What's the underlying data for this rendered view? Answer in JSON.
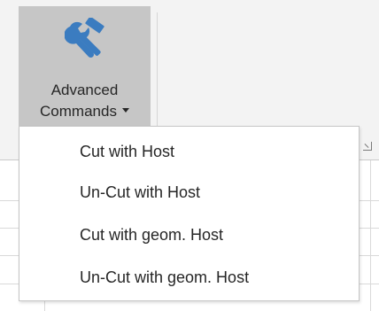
{
  "ribbon": {
    "advanced_button": {
      "label_line1": "Advanced",
      "label_line2": "Commands",
      "icon": "tools-icon"
    }
  },
  "menu": {
    "items": [
      {
        "label": "Cut with Host"
      },
      {
        "label": "Un-Cut with Host"
      },
      {
        "label": "Cut with geom. Host"
      },
      {
        "label": "Un-Cut with geom. Host"
      }
    ]
  },
  "colors": {
    "button_pressed": "#c6c6c6",
    "icon_blue": "#2e75b6",
    "ribbon_bg": "#f3f3f3"
  }
}
